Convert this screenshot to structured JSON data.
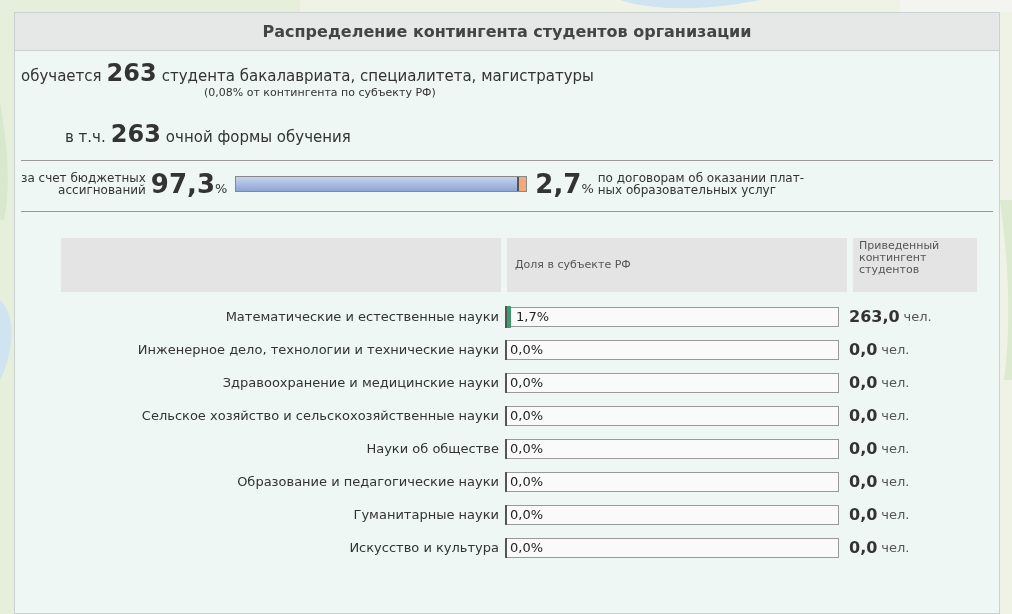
{
  "title": "Распределение контингента студентов организации",
  "summary": {
    "prefix": "обучается",
    "count": "263",
    "suffix": "студента бакалавриата, специалитета, магистратуры",
    "note": "(0,08% от контингента по субъекту РФ)"
  },
  "fulltime": {
    "prefix": "в т.ч.",
    "count": "263",
    "suffix": "очной формы обучения"
  },
  "funding": {
    "budget_lines": [
      "за счет бюджетных",
      "ассигнований"
    ],
    "budget_value": "97,3",
    "budget_unit": "%",
    "level": 0.973,
    "paid_value": "2,7",
    "paid_unit": "%",
    "paid_lines": [
      "по договорам об оказании плат-",
      "ных образовательных услуг"
    ]
  },
  "table": {
    "columns": [
      "Доля в субъекте РФ",
      "Приведенный контингент студентов"
    ],
    "rows": [
      {
        "name": "Математические и естественные науки",
        "share": "1,7%",
        "level": 0.017,
        "value": "263,0",
        "unit": "чел."
      },
      {
        "name": "Инженерное дело, технологии и технические науки",
        "share": "0,0%",
        "level": 0,
        "value": "0,0",
        "unit": "чел."
      },
      {
        "name": "Здравоохранение и медицинские науки",
        "share": "0,0%",
        "level": 0,
        "value": "0,0",
        "unit": "чел."
      },
      {
        "name": "Сельское хозяйство и сельскохозяйственные науки",
        "share": "0,0%",
        "level": 0,
        "value": "0,0",
        "unit": "чел."
      },
      {
        "name": "Науки об обществе",
        "share": "0,0%",
        "level": 0,
        "value": "0,0",
        "unit": "чел."
      },
      {
        "name": "Образование и педагогические науки",
        "share": "0,0%",
        "level": 0,
        "value": "0,0",
        "unit": "чел."
      },
      {
        "name": "Гуманитарные науки",
        "share": "0,0%",
        "level": 0,
        "value": "0,0",
        "unit": "чел."
      },
      {
        "name": "Искусство и культура",
        "share": "0,0%",
        "level": 0,
        "value": "0,0",
        "unit": "чел."
      }
    ]
  }
}
